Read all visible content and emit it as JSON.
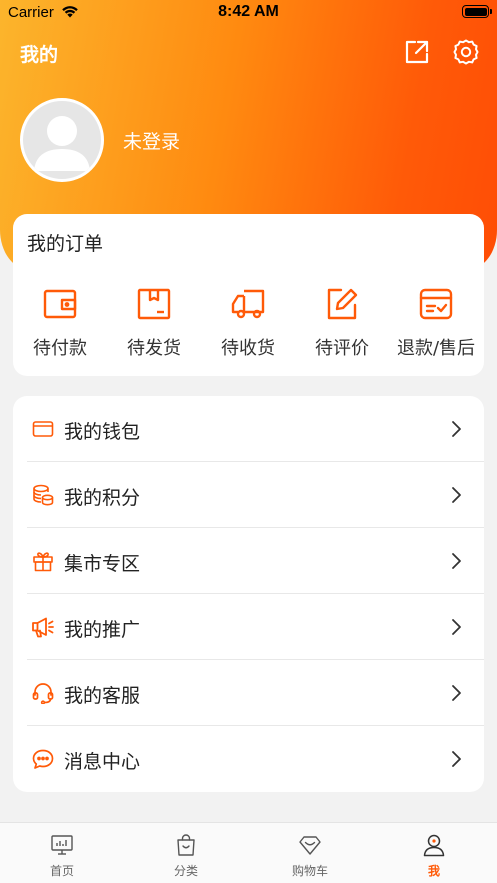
{
  "status_bar": {
    "carrier": "Carrier",
    "time": "8:42 AM"
  },
  "header": {
    "title": "我的",
    "login_text": "未登录"
  },
  "orders": {
    "title": "我的订单",
    "items": [
      {
        "label": "待付款",
        "icon": "wallet-icon"
      },
      {
        "label": "待发货",
        "icon": "package-icon"
      },
      {
        "label": "待收货",
        "icon": "truck-icon"
      },
      {
        "label": "待评价",
        "icon": "edit-icon"
      },
      {
        "label": "退款/售后",
        "icon": "refund-icon"
      }
    ]
  },
  "menu": {
    "items": [
      {
        "label": "我的钱包",
        "icon": "wallet-icon"
      },
      {
        "label": "我的积分",
        "icon": "coins-icon"
      },
      {
        "label": "集市专区",
        "icon": "gift-icon"
      },
      {
        "label": "我的推广",
        "icon": "megaphone-icon"
      },
      {
        "label": "我的客服",
        "icon": "headset-icon"
      },
      {
        "label": "消息中心",
        "icon": "message-icon"
      }
    ]
  },
  "tabbar": {
    "items": [
      {
        "label": "首页",
        "icon": "home-monitor-icon"
      },
      {
        "label": "分类",
        "icon": "bag-icon"
      },
      {
        "label": "购物车",
        "icon": "diamond-icon"
      },
      {
        "label": "我",
        "icon": "user-icon",
        "active": true
      }
    ]
  },
  "colors": {
    "accent": "#ff5a08",
    "gradient_start": "#fcb52c",
    "gradient_end": "#ff4d05"
  }
}
